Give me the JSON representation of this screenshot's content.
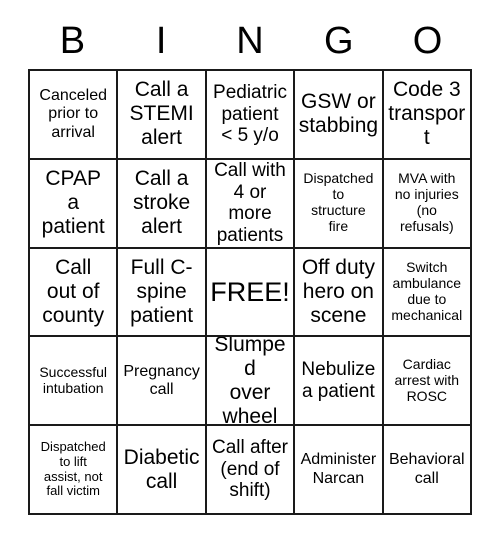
{
  "header": {
    "letters": [
      "B",
      "I",
      "N",
      "G",
      "O"
    ]
  },
  "grid": {
    "rows": 5,
    "columns": 5,
    "border_color": "#1a1a1a",
    "cell_background": "#ffffff",
    "text_color": "#000000",
    "cells": [
      {
        "text": "Canceled\nprior to\narrival",
        "size": "sz-sm"
      },
      {
        "text": "Call a\nSTEMI\nalert",
        "size": "sz-lg"
      },
      {
        "text": "Pediatric\npatient\n< 5 y/o",
        "size": "sz-md"
      },
      {
        "text": "GSW or\nstabbing",
        "size": "sz-lg"
      },
      {
        "text": "Code 3\ntransport",
        "size": "sz-lg"
      },
      {
        "text": "CPAP\na\npatient",
        "size": "sz-lg"
      },
      {
        "text": "Call a\nstroke\nalert",
        "size": "sz-lg"
      },
      {
        "text": "Call with\n4 or more\npatients",
        "size": "sz-md"
      },
      {
        "text": "Dispatched\nto\nstructure\nfire",
        "size": "sz-xs"
      },
      {
        "text": "MVA with\nno injuries\n(no\nrefusals)",
        "size": "sz-xs"
      },
      {
        "text": "Call\nout of\ncounty",
        "size": "sz-lg"
      },
      {
        "text": "Full C-\nspine\npatient",
        "size": "sz-lg"
      },
      {
        "text": "FREE!",
        "size": "sz-xl"
      },
      {
        "text": "Off duty\nhero on\nscene",
        "size": "sz-lg"
      },
      {
        "text": "Switch\nambulance\ndue to\nmechanical",
        "size": "sz-xs"
      },
      {
        "text": "Successful\nintubation",
        "size": "sz-xs"
      },
      {
        "text": "Pregnancy\ncall",
        "size": "sz-sm"
      },
      {
        "text": "Slumped\nover\nwheel",
        "size": "sz-lg"
      },
      {
        "text": "Nebulize\na patient",
        "size": "sz-md"
      },
      {
        "text": "Cardiac\narrest with\nROSC",
        "size": "sz-xs"
      },
      {
        "text": "Dispatched\nto lift\nassist, not\nfall victim",
        "size": "sz-xxs"
      },
      {
        "text": "Diabetic\ncall",
        "size": "sz-lg"
      },
      {
        "text": "Call after\n(end of\nshift)",
        "size": "sz-md"
      },
      {
        "text": "Administer\nNarcan",
        "size": "sz-sm"
      },
      {
        "text": "Behavioral\ncall",
        "size": "sz-sm"
      }
    ]
  }
}
